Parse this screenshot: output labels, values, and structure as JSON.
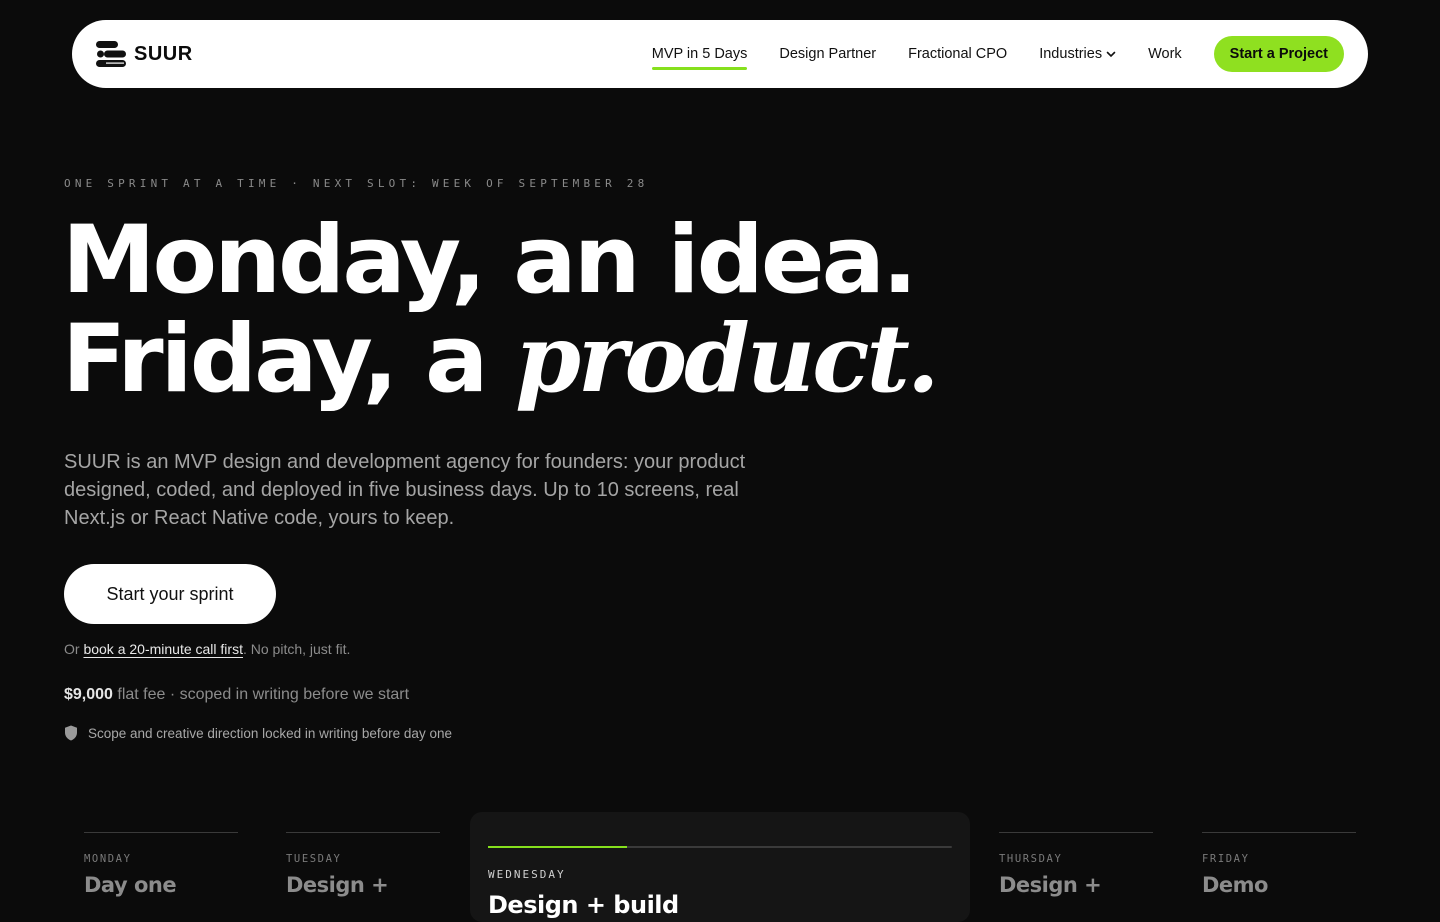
{
  "nav": {
    "brand": "SUUR",
    "links": [
      {
        "label": "MVP in 5 Days",
        "active": true
      },
      {
        "label": "Design Partner"
      },
      {
        "label": "Fractional CPO"
      },
      {
        "label": "Industries",
        "dropdown": true
      },
      {
        "label": "Work"
      }
    ],
    "cta_label": "Start a Project"
  },
  "hero": {
    "eyebrow": "ONE SPRINT AT A TIME · NEXT SLOT: WEEK OF SEPTEMBER 28",
    "headline_line1": "Monday, an idea.",
    "headline_line2_prefix": "Friday, a ",
    "headline_line2_emphasis": "product.",
    "lede": "SUUR is an MVP design and development agency for founders: your product designed, coded, and deployed in five business days. Up to 10 screens, real Next.js or React Native code, yours to keep.",
    "primary_button": "Start your sprint",
    "alt_prefix": "Or ",
    "alt_link": "book a 20-minute call first",
    "alt_suffix": ". No pitch, just fit.",
    "price_amount": "$9,000",
    "price_note": " flat fee · scoped in writing before we start",
    "assurance": "Scope and creative direction locked in writing before day one"
  },
  "days": [
    {
      "label": "MONDAY",
      "title": "Day one"
    },
    {
      "label": "TUESDAY",
      "title": "Design +"
    },
    {
      "label": "WEDNESDAY",
      "title": "Design + build",
      "active": true,
      "progress": 0.3
    },
    {
      "label": "THURSDAY",
      "title": "Design +"
    },
    {
      "label": "FRIDAY",
      "title": "Demo"
    }
  ],
  "colors": {
    "background": "#0b0b0b",
    "accent": "#8fe020",
    "nav_background": "#ffffff"
  },
  "icons": {
    "logo": "stacked-bars-logo-icon",
    "dropdown": "chevron-down-icon",
    "assurance": "shield-icon"
  }
}
